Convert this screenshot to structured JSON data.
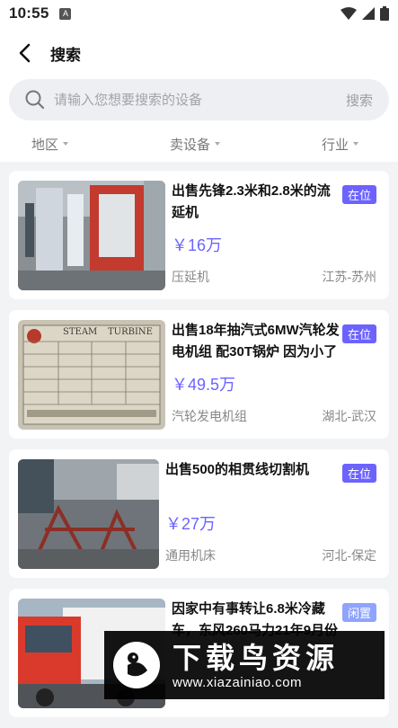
{
  "status_bar": {
    "time": "10:55",
    "sim_label": "A"
  },
  "header": {
    "title": "搜索"
  },
  "search": {
    "placeholder": "请输入您想要搜索的设备",
    "button_label": "搜索"
  },
  "filters": [
    {
      "label": "地区"
    },
    {
      "label": "卖设备"
    },
    {
      "label": "行业"
    }
  ],
  "items": [
    {
      "title": "出售先锋2.3米和2.8米的流延机",
      "price": "￥16万",
      "category": "压延机",
      "location": "江苏-苏州",
      "status": "在位"
    },
    {
      "title": "出售18年抽汽式6MW汽轮发电机组 配30T锅炉 因为小了",
      "price": "￥49.5万",
      "category": "汽轮发电机组",
      "location": "湖北-武汉",
      "status": "在位"
    },
    {
      "title": "出售500的相贯线切割机",
      "price": "￥27万",
      "category": "通用机床",
      "location": "河北-保定",
      "status": "在位"
    },
    {
      "title": "因家中有事转让6.8米冷藏车，东风260马力21年9月份",
      "price": "",
      "category": "",
      "location": "",
      "status": "闲置"
    }
  ],
  "turbine_plate": {
    "line1": "STEAM",
    "line2": "TURBINE"
  },
  "watermark": {
    "main": "下载鸟资源",
    "url": "www.xiazainiao.com"
  },
  "colors": {
    "accent": "#6c63ff",
    "idle_badge": "#8fa3ff",
    "background": "#f2f3f5"
  }
}
